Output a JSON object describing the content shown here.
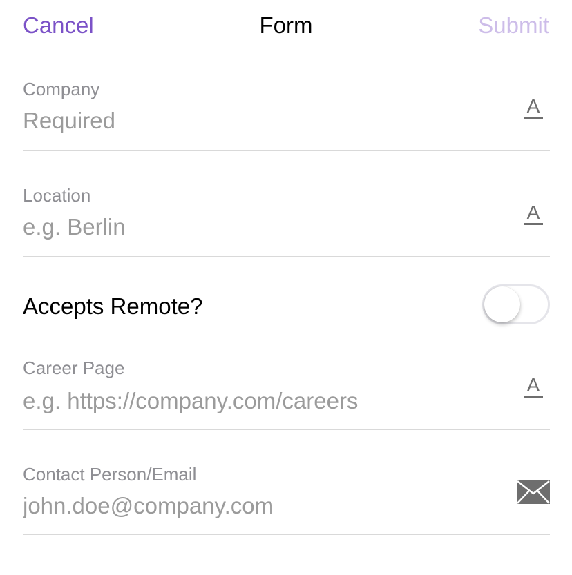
{
  "nav": {
    "cancel_label": "Cancel",
    "title": "Form",
    "submit_label": "Submit"
  },
  "fields": [
    {
      "label": "Company",
      "placeholder": "Required",
      "icon": "text-format-icon"
    },
    {
      "label": "Location",
      "placeholder": "e.g. Berlin",
      "icon": "text-format-icon"
    },
    {
      "label": "Career Page",
      "placeholder": "e.g. https://company.com/careers",
      "icon": "text-format-icon"
    },
    {
      "label": "Contact Person/Email",
      "placeholder": "john.doe@company.com",
      "icon": "envelope-icon"
    }
  ],
  "toggle": {
    "label": "Accepts Remote?",
    "on": false
  },
  "colors": {
    "accent": "#7b52c7",
    "accent_disabled": "#cdbde9",
    "label_gray": "#8e8e93",
    "placeholder_gray": "#9b9b9b",
    "divider": "#d9d9d9",
    "icon_gray": "#6e6e6e"
  }
}
